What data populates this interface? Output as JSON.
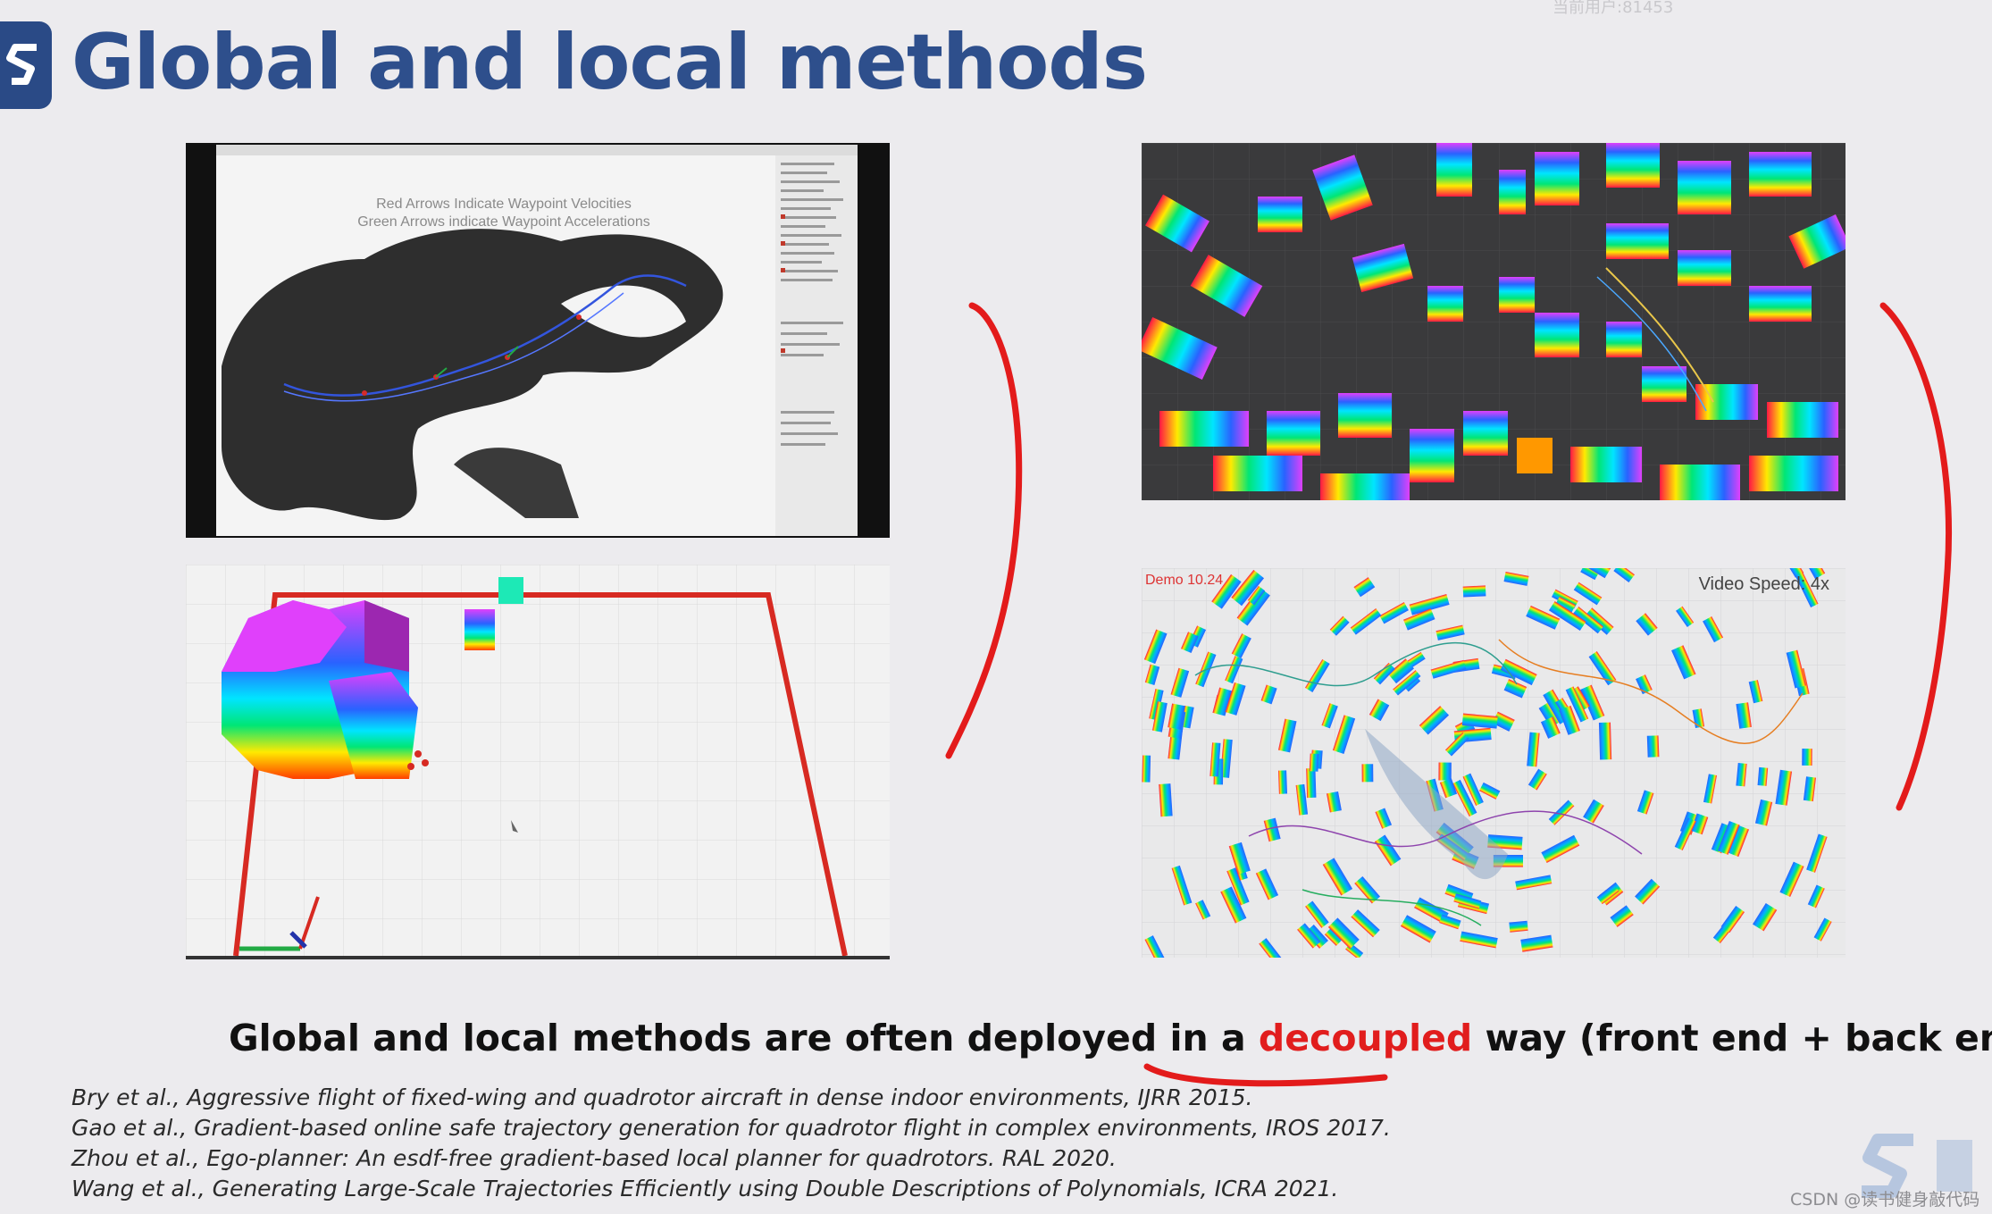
{
  "header": {
    "title": "Global and local methods",
    "watermark_top": "当前用户:81453"
  },
  "panels": {
    "top_left": {
      "overlay_line1": "Red Arrows Indicate Waypoint Velocities",
      "overlay_line2": "Green Arrows indicate Waypoint Accelerations"
    },
    "bottom_right": {
      "speed_label": "Video Speed: 4x",
      "corner_label": "Demo 10.24"
    }
  },
  "caption": {
    "before": "Global and local methods are often deployed in a ",
    "highlight": "decoupled",
    "after": " way (front end + back end)."
  },
  "references": [
    "Bry et al., Aggressive flight of fixed-wing and quadrotor aircraft in dense indoor environments, IJRR 2015.",
    "Gao et al., Gradient-based online safe trajectory generation for quadrotor flight in complex environments, IROS 2017.",
    "Zhou et al., Ego-planner: An esdf-free gradient-based local planner for quadrotors. RAL 2020.",
    "Wang et al., Generating Large-Scale Trajectories Efficiently using Double Descriptions of Polynomials, ICRA 2021."
  ],
  "footer": {
    "csdn_watermark": "CSDN @读书健身敲代码"
  },
  "colors": {
    "title_blue": "#2e4f8c",
    "highlight_red": "#e11d1d",
    "annotation_red": "#e31b1b"
  }
}
